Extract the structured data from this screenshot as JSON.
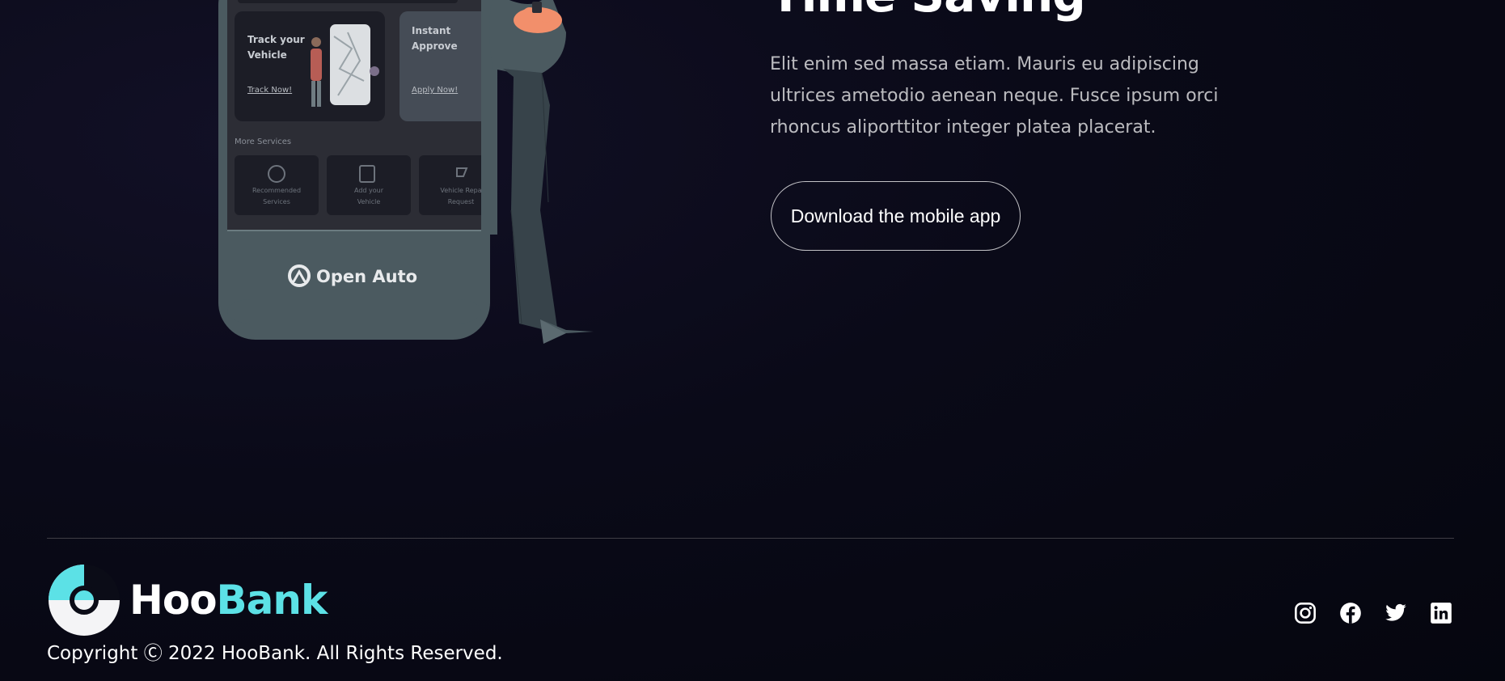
{
  "hero": {
    "heading": "Time Saving",
    "text": "Elit enim sed massa etiam. Mauris eu adipiscing ultrices ametodio aenean neque. Fusce ipsum orci rhoncus aliporttitor integer platea placerat.",
    "cta_label": "Download the mobile app"
  },
  "phone": {
    "card1": {
      "title_line1": "Track your",
      "title_line2": "Vehicle",
      "link": "Track Now!"
    },
    "card2": {
      "title_line1": "Instant",
      "title_line2": "Approve",
      "link": "Apply Now!"
    },
    "more_services_label": "More Services",
    "services": [
      {
        "line1": "Recommended",
        "line2": "Services"
      },
      {
        "line1": "Add your",
        "line2": "Vehicle"
      },
      {
        "line1": "Vehicle Repa",
        "line2": "Request"
      }
    ],
    "brand": "Open Auto"
  },
  "footer": {
    "logo": {
      "hoo": "Hoo",
      "bank": "Bank"
    },
    "copyright": "Copyright Ⓒ 2022 HooBank. All Rights Reserved.",
    "socials": [
      "instagram-icon",
      "facebook-icon",
      "twitter-icon",
      "linkedin-icon"
    ]
  },
  "colors": {
    "accent": "#5ce1e6",
    "background": "#05060f",
    "phone": "#4b5a60"
  }
}
